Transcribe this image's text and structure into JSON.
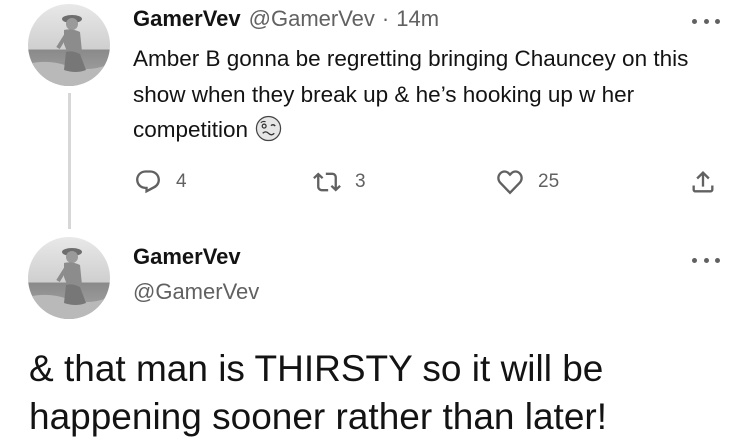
{
  "tweet1": {
    "display_name": "GamerVev",
    "handle": "@GamerVev",
    "separator": "·",
    "time": "14m",
    "text": "Amber B gonna be regretting bringing Chauncey on this show when they break up & he’s hooking up w her competition",
    "emoji": "woozy-face",
    "actions": {
      "reply_count": "4",
      "retweet_count": "3",
      "like_count": "25"
    }
  },
  "tweet2": {
    "display_name": "GamerVev",
    "handle": "@GamerVev",
    "text": "& that man is THIRSTY so it will be happening sooner rather than later!"
  },
  "icons": {
    "reply": "reply-icon",
    "retweet": "retweet-icon",
    "like": "heart-icon",
    "share": "share-icon",
    "more": "more-icon"
  },
  "colors": {
    "text_primary": "#0f1419",
    "text_secondary": "#536471",
    "thread_line": "#cfd9de"
  }
}
